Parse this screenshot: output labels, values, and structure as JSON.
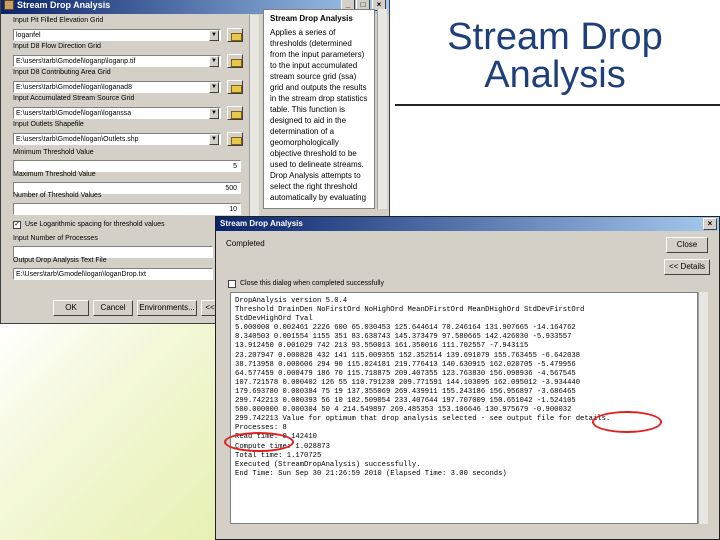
{
  "slide": {
    "title": "Stream Drop Analysis"
  },
  "tool_dialog": {
    "title": "Stream Drop Analysis",
    "fields": [
      {
        "label": "Input Pit Filled Elevation Grid",
        "value": "loganfel"
      },
      {
        "label": "Input D8 Flow Direction Grid",
        "value": "E:\\users\\tarb\\Gmodel\\loganp\\loganp.tif"
      },
      {
        "label": "Input D8 Contributing Area Grid",
        "value": "E:\\users\\tarb\\Gmodel\\logan\\loganad8"
      },
      {
        "label": "Input Accumulated Stream Source Grid",
        "value": "E:\\users\\tarb\\Gmodel\\logan\\loganssa"
      },
      {
        "label": "Input Outlets Shapefile",
        "value": "E:\\users\\tarb\\Gmodel\\logan\\Outlets.shp"
      },
      {
        "label": "Minimum Threshold Value",
        "value": "5"
      },
      {
        "label": "Maximum Threshold Value",
        "value": "500"
      },
      {
        "label": "Number of Threshold Values",
        "value": "10"
      },
      {
        "label": "Input Number of Processes",
        "value": ""
      },
      {
        "label": "Output Drop Analysis Text File",
        "value": "E:\\Users\\tarb\\Gmodel\\logan\\loganDrop.txt"
      }
    ],
    "checkbox_label": "Use Logarithmic spacing for threshold values",
    "buttons": {
      "ok": "OK",
      "cancel": "Cancel",
      "environments": "Environments...",
      "hide_help": "<< Hide Help"
    },
    "help": {
      "title": "Stream Drop Analysis",
      "body": "Applies a series of thresholds (determined from the input parameters) to the input accumulated stream source grid (ssa) grid and outputs the results in the stream drop statistics table. This function is designed to aid in the determination of a geomorphologically objective threshold to be used to delineate streams. Drop Analysis attempts to select the right threshold automatically by evaluating"
    }
  },
  "progress_dialog": {
    "title": "Stream Drop Analysis",
    "status": "Completed",
    "close_button": "Close",
    "details_button": "<< Details",
    "close_checkbox_label": "Close this dialog when completed successfully",
    "output_lines": [
      "DropAnalysis version 5.0.4",
      "Threshold DrainDen NoFirstOrd NoHighOrd MeanDFirstOrd MeanDHighOrd StdDevFirstOrd",
      "StdDevHighOrd Tval",
      "5.000000 0.002461 2226 600 65.030453 125.644614 70.246164 131.907665 -14.164762",
      "8.340503 0.001554 1155 351 83.638743 145.373479 97.580665 142.426030 -5.933557",
      "13.912450 0.001029 742 213 93.550013 161.350016 111.702557 -7.943115",
      "23.207947 0.000828 432 141 115.009355 152.352514 139.691079 155.763455 -6.642038",
      "38.713958 0.000606 294 90 115.024181 219.776413 140.630915 162.020705 -5.479956",
      "64.577459 0.000479 186 70 115.718875 209.407355 123.763830 156.098936 -4.567545",
      "107.721578 0.000402 126 55 110.791230 209.771591 144.103095 162.095012 -3.934440",
      "179.693780 0.000384 75 19 137.355069 269.439911 155.243186 156.956897 -3.686465",
      "299.742213 0.000393 56 10 182.509054 233.407644 197.707009 150.651042 -1.524105",
      "500.000000 0.000304 50 4 214.549897 269.485353 153.106646 130.975679 -0.900032",
      "299.742213 Value for optimum that drop analysis selected - see output file for details.",
      "Processes: 8",
      "Read time: 0.142410",
      "Compute time: 1.028873",
      "Total time: 1.170725",
      "",
      "Executed (StreamDropAnalysis) successfully.",
      "End Time: Sun Sep 30 21:26:59 2010 (Elapsed Time: 3.00 seconds)"
    ]
  },
  "colors": {
    "title_blue": "#1f3f7a",
    "annotation_red": "#e02020",
    "titlebar_start": "#0a246a"
  }
}
